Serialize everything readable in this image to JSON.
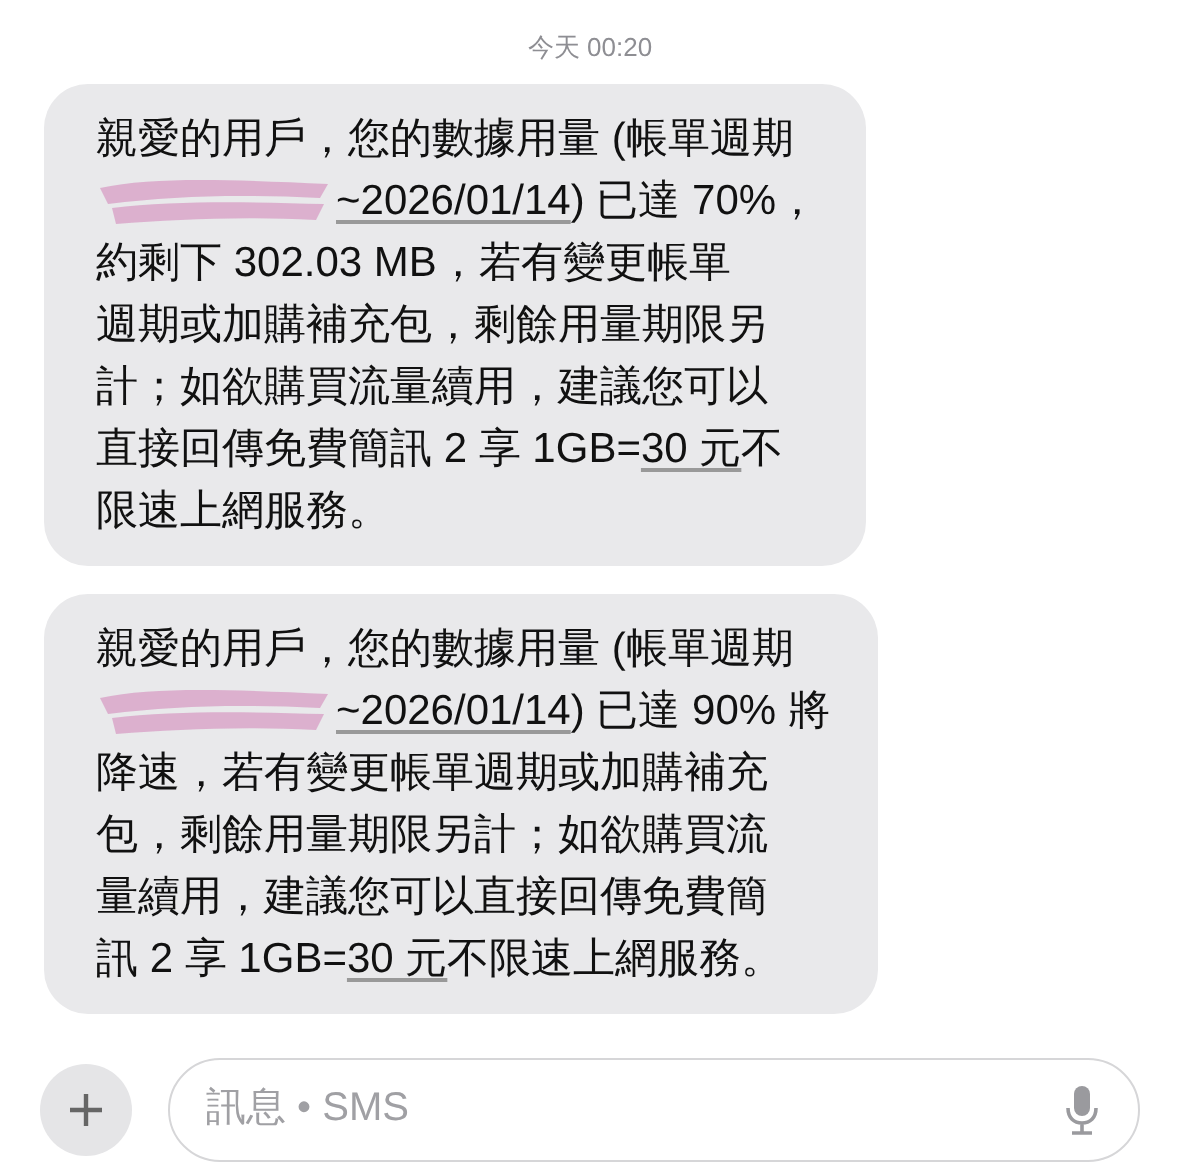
{
  "timestamp": "今天 00:20",
  "messages": [
    {
      "lines": [
        {
          "redacted": false,
          "segments": [
            {
              "kind": "text",
              "text": "親愛的用戶，您的數據用量 (帳單週期"
            }
          ]
        },
        {
          "redacted": true,
          "segments": [
            {
              "kind": "link",
              "text": "~2026/01/14"
            },
            {
              "kind": "text",
              "text": ") 已達 70%，"
            }
          ]
        },
        {
          "redacted": false,
          "segments": [
            {
              "kind": "text",
              "text": "約剩下 302.03 MB，若有變更帳單"
            }
          ]
        },
        {
          "redacted": false,
          "segments": [
            {
              "kind": "text",
              "text": "週期或加購補充包，剩餘用量期限另"
            }
          ]
        },
        {
          "redacted": false,
          "segments": [
            {
              "kind": "text",
              "text": "計；如欲購買流量續用，建議您可以"
            }
          ]
        },
        {
          "redacted": false,
          "segments": [
            {
              "kind": "text",
              "text": "直接回傳免費簡訊 2 享 1GB="
            },
            {
              "kind": "link",
              "text": "30 元"
            },
            {
              "kind": "text",
              "text": "不"
            }
          ]
        },
        {
          "redacted": false,
          "segments": [
            {
              "kind": "text",
              "text": "限速上網服務。"
            }
          ]
        }
      ]
    },
    {
      "lines": [
        {
          "redacted": false,
          "segments": [
            {
              "kind": "text",
              "text": "親愛的用戶，您的數據用量 (帳單週期"
            }
          ]
        },
        {
          "redacted": true,
          "segments": [
            {
              "kind": "link",
              "text": "~2026/01/14"
            },
            {
              "kind": "text",
              "text": ") 已達 90% 將"
            }
          ]
        },
        {
          "redacted": false,
          "segments": [
            {
              "kind": "text",
              "text": "降速，若有變更帳單週期或加購補充"
            }
          ]
        },
        {
          "redacted": false,
          "segments": [
            {
              "kind": "text",
              "text": "包，剩餘用量期限另計；如欲購買流"
            }
          ]
        },
        {
          "redacted": false,
          "segments": [
            {
              "kind": "text",
              "text": "量續用，建議您可以直接回傳免費簡"
            }
          ]
        },
        {
          "redacted": false,
          "segments": [
            {
              "kind": "text",
              "text": "訊 2 享 1GB="
            },
            {
              "kind": "link",
              "text": "30 元"
            },
            {
              "kind": "text",
              "text": "不限速上網服務。"
            }
          ]
        }
      ]
    }
  ],
  "composer": {
    "placeholder": "訊息 • SMS"
  }
}
